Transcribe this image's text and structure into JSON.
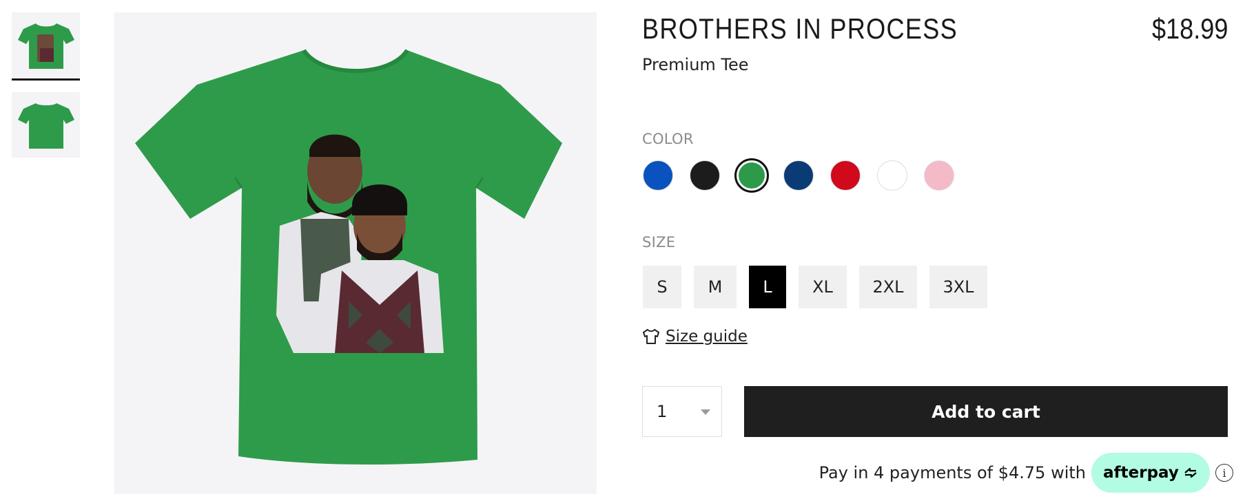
{
  "product": {
    "title": "BROTHERS IN PROCESS",
    "subtitle": "Premium Tee",
    "price": "$18.99"
  },
  "gallery": {
    "thumbnails": [
      {
        "icon": "tshirt-front-thumbnail",
        "selected": true
      },
      {
        "icon": "tshirt-back-thumbnail",
        "selected": false
      }
    ],
    "main_image": {
      "icon": "green-tshirt-illustration",
      "shirt_color": "#2e9b4a"
    }
  },
  "color": {
    "label": "COLOR",
    "options": [
      {
        "name": "blue",
        "hex": "#0a53be"
      },
      {
        "name": "black",
        "hex": "#1c1c1c"
      },
      {
        "name": "green",
        "hex": "#2d9a4a",
        "selected": true
      },
      {
        "name": "navy",
        "hex": "#0b3b74"
      },
      {
        "name": "red",
        "hex": "#d0091b"
      },
      {
        "name": "white",
        "hex": "#ffffff"
      },
      {
        "name": "pink",
        "hex": "#f5bac8"
      }
    ]
  },
  "size": {
    "label": "SIZE",
    "options": [
      "S",
      "M",
      "L",
      "XL",
      "2XL",
      "3XL"
    ],
    "selected": "L",
    "guide_label": "Size guide"
  },
  "cart": {
    "quantity": "1",
    "add_label": "Add to cart"
  },
  "afterpay": {
    "text": "Pay in 4 payments of $4.75 with",
    "brand": "afterpay",
    "info": "i",
    "badge_color": "#b2fce4"
  }
}
